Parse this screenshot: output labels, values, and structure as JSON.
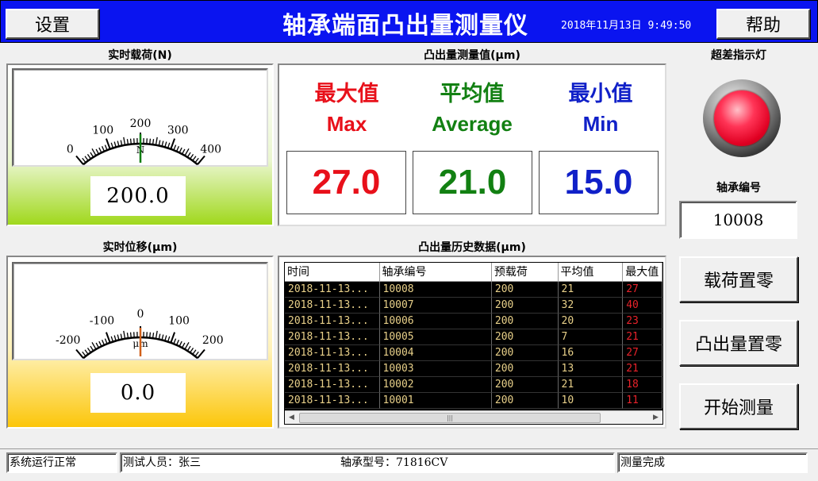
{
  "header": {
    "settings_label": "设置",
    "title": "轴承端面凸出量测量仪",
    "datetime": "2018年11月13日 9:49:50",
    "help_label": "帮助"
  },
  "load_gauge": {
    "title": "实时载荷(N)",
    "unit": "N",
    "min": 0,
    "max": 400,
    "ticks": [
      "0",
      "100",
      "200",
      "300",
      "400"
    ],
    "value": 200,
    "display": "200.0",
    "needle_color": "#0a7d10"
  },
  "displacement_gauge": {
    "title": "实时位移(μm)",
    "unit": "μm",
    "min": -200,
    "max": 200,
    "ticks": [
      "-200",
      "-100",
      "0",
      "100",
      "200"
    ],
    "value": 0,
    "display": "0.0",
    "needle_color": "#d0601a"
  },
  "measurement": {
    "title": "凸出量测量值(μm)",
    "max": {
      "label_cn": "最大值",
      "label_en": "Max",
      "value": "27.0",
      "color": "#e8101a"
    },
    "avg": {
      "label_cn": "平均值",
      "label_en": "Average",
      "value": "21.0",
      "color": "#128012"
    },
    "min": {
      "label_cn": "最小值",
      "label_en": "Min",
      "value": "15.0",
      "color": "#1020c8"
    }
  },
  "indicator": {
    "title": "超差指示灯",
    "state_color": "#ff2040"
  },
  "bearing": {
    "label": "轴承编号",
    "number": "10008"
  },
  "buttons": {
    "zero_load": "载荷置零",
    "zero_protrusion": "凸出量置零",
    "start": "开始测量"
  },
  "history": {
    "title": "凸出量历史数据(μm)",
    "columns": [
      "时间",
      "轴承编号",
      "预载荷",
      "平均值",
      "最大值"
    ],
    "rows": [
      [
        "2018-11-13...",
        "10008",
        "200",
        "21",
        "27"
      ],
      [
        "2018-11-13...",
        "10007",
        "200",
        "32",
        "40"
      ],
      [
        "2018-11-13...",
        "10006",
        "200",
        "20",
        "23"
      ],
      [
        "2018-11-13...",
        "10005",
        "200",
        "7",
        "21"
      ],
      [
        "2018-11-13...",
        "10004",
        "200",
        "16",
        "27"
      ],
      [
        "2018-11-13...",
        "10003",
        "200",
        "13",
        "21"
      ],
      [
        "2018-11-13...",
        "10002",
        "200",
        "21",
        "18"
      ],
      [
        "2018-11-13...",
        "10001",
        "200",
        "10",
        "11"
      ]
    ]
  },
  "statusbar": {
    "status": "系统运行正常",
    "operator": "测试人员：张三",
    "model": "轴承型号：71816CV",
    "result": "测量完成"
  }
}
